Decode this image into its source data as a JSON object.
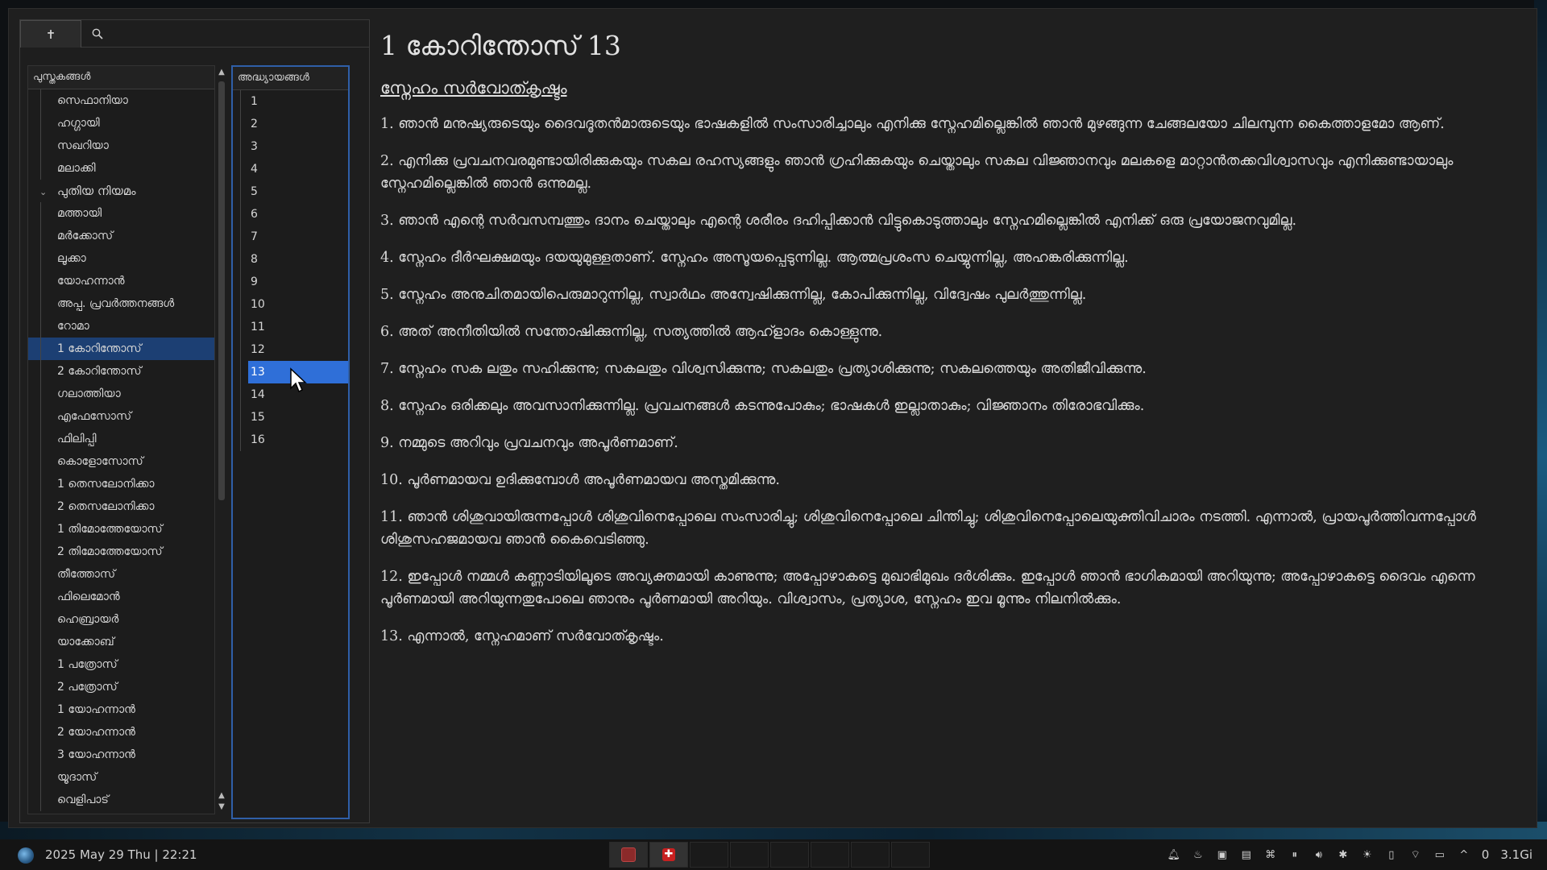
{
  "left_panel": {
    "tabs": [
      {
        "icon": "cross-icon",
        "glyph": "✝"
      },
      {
        "icon": "search-icon",
        "glyph": "🔍"
      }
    ],
    "books_header": "പുസ്തകങ്ങൾ",
    "chapters_header": "അദ്ധ്യായങ്ങൾ",
    "books": [
      {
        "label": "സെഫാനിയാ",
        "type": "book"
      },
      {
        "label": "ഹഗ്ഗായി",
        "type": "book"
      },
      {
        "label": "സഖറിയാ",
        "type": "book"
      },
      {
        "label": "മലാക്കി",
        "type": "book"
      },
      {
        "label": "പുതിയ നിയമം",
        "type": "section"
      },
      {
        "label": "മത്തായി",
        "type": "book"
      },
      {
        "label": "മർക്കോസ്",
        "type": "book"
      },
      {
        "label": "ലൂക്കാ",
        "type": "book"
      },
      {
        "label": "യോഹന്നാൻ",
        "type": "book"
      },
      {
        "label": "അപ്പ. പ്രവർത്തനങ്ങൾ",
        "type": "book"
      },
      {
        "label": "റോമാ",
        "type": "book"
      },
      {
        "label": "1 കോറിന്തോസ്",
        "type": "book",
        "selected": true
      },
      {
        "label": "2 കോറിന്തോസ്",
        "type": "book"
      },
      {
        "label": "ഗലാത്തിയാ",
        "type": "book"
      },
      {
        "label": "എഫേസോസ്",
        "type": "book"
      },
      {
        "label": "ഫിലിപ്പി",
        "type": "book"
      },
      {
        "label": "കൊളോസോസ്",
        "type": "book"
      },
      {
        "label": "1 തെസലോനിക്കാ",
        "type": "book"
      },
      {
        "label": "2 തെസലോനിക്കാ",
        "type": "book"
      },
      {
        "label": "1 തിമോത്തേയോസ്",
        "type": "book"
      },
      {
        "label": "2 തിമോത്തേയോസ്",
        "type": "book"
      },
      {
        "label": "തീത്തോസ്",
        "type": "book"
      },
      {
        "label": "ഫിലെമോൻ",
        "type": "book"
      },
      {
        "label": "ഹെബ്രായർ",
        "type": "book"
      },
      {
        "label": "യാക്കോബ്",
        "type": "book"
      },
      {
        "label": "1 പത്രോസ്",
        "type": "book"
      },
      {
        "label": "2 പത്രോസ്",
        "type": "book"
      },
      {
        "label": "1 യോഹന്നാൻ",
        "type": "book"
      },
      {
        "label": "2 യോഹന്നാൻ",
        "type": "book"
      },
      {
        "label": "3 യോഹന്നാൻ",
        "type": "book"
      },
      {
        "label": "യൂദാസ്",
        "type": "book"
      },
      {
        "label": "വെളിപാട്",
        "type": "book"
      }
    ],
    "chapters": [
      "1",
      "2",
      "3",
      "4",
      "5",
      "6",
      "7",
      "8",
      "9",
      "10",
      "11",
      "12",
      "13",
      "14",
      "15",
      "16"
    ],
    "selected_chapter": "13"
  },
  "content": {
    "chapter_title": "1 കോറിന്തോസ് 13",
    "section_heading": "സ്നേഹം സർവോത്കൃഷ്ടം",
    "verses": [
      "1. ഞാൻ മനുഷ്യരുടെയും ദൈവദൂതൻമാരുടെയും ഭാഷകളിൽ സംസാരിച്ചാലും എനിക്കു സ്നേഹമില്ലെങ്കിൽ ഞാൻ മുഴങ്ങുന്ന ചേങ്ങലയോ ചിലമ്പുന്ന കൈത്താളമോ ആണ്.",
      "2. എനിക്കു പ്രവചനവരമുണ്ടായിരിക്കുകയും സകല രഹസ്യങ്ങളും ഞാൻ ഗ്രഹിക്കുകയും ചെയ്താലും സകല വിജ്ഞാനവും മലകളെ മാറ്റാൻതക്കവിശ്വാസവും എനിക്കുണ്ടായാലും സ്നേഹമില്ലെങ്കിൽ ഞാൻ ഒന്നുമല്ല.",
      "3. ഞാൻ എന്റെ സർവസമ്പത്തും ദാനം ചെയ്താലും എന്റെ ശരീരം ദഹിപ്പിക്കാൻ വിട്ടുകൊടുത്താലും സ്നേഹമില്ലെങ്കിൽ എനിക്ക് ഒരു പ്രയോജനവുമില്ല.",
      "4. സ്നേഹം ദീർഘക്ഷമയും ദയയുമുള്ളതാണ്. സ്നേഹം അസൂയപ്പെടുന്നില്ല. ആത്മപ്രശംസ ചെയ്യുന്നില്ല, അഹങ്കരിക്കുന്നില്ല.",
      "5. സ്നേഹം അനുചിതമായിപെരുമാറുന്നില്ല, സ്വാർഥം അന്വേഷിക്കുന്നില്ല, കോപിക്കുന്നില്ല, വിദ്വേഷം പുലർത്തുന്നില്ല.",
      "6. അത് അനീതിയിൽ സന്തോഷിക്കുന്നില്ല, സത്യത്തിൽ ആഹ്ളാദം കൊള്ളുന്നു.",
      "7. സ്നേഹം സക ലതും സഹിക്കുന്നു; സകലതും വിശ്വസിക്കുന്നു; സകലതും പ്രത്യാശിക്കുന്നു; സകലത്തെയും അതിജീവിക്കുന്നു.",
      "8. സ്നേഹം ഒരിക്കലും അവസാനിക്കുന്നില്ല. പ്രവചനങ്ങൾ കടന്നുപോകും; ഭാഷകൾ ഇല്ലാതാകും; വിജ്ഞാനം തിരോഭവിക്കും.",
      "9. നമ്മുടെ അറിവും പ്രവചനവും അപൂർണമാണ്.",
      "10. പൂർണമായവ ഉദിക്കുമ്പോൾ അപൂർണമായവ അസ്തമിക്കുന്നു.",
      "11. ഞാൻ ശിശുവായിരുന്നപ്പോൾ ശിശുവിനെപ്പോലെ സംസാരിച്ചു; ശിശുവിനെപ്പോലെ ചിന്തിച്ചു; ശിശുവിനെപ്പോലെയുക്തിവിചാരം നടത്തി. എന്നാൽ, പ്രായപൂർത്തിവന്നപ്പോൾ ശിശുസഹജമായവ ഞാൻ കൈവെടിഞ്ഞു.",
      "12. ഇപ്പോൾ നമ്മൾ കണ്ണാടിയിലൂടെ അവ്യക്തമായി കാണുന്നു; അപ്പോഴാകട്ടെ മുഖാഭിമുഖം ദർശിക്കും. ഇപ്പോൾ ഞാൻ ഭാഗികമായി അറിയുന്നു; അപ്പോഴാകട്ടെ ദൈവം എന്നെ പൂർണമായി അറിയുന്നതുപോലെ ഞാനും പൂർണമായി അറിയും. വിശ്വാസം, പ്രത്യാശ, സ്നേഹം ഇവ മൂന്നും നിലനിൽക്കും.",
      "13. എന്നാൽ, സ്നേഹമാണ് സർവോത്കൃഷ്ടം."
    ]
  },
  "taskbar": {
    "clock": "2025 May 29 Thu | 22:21",
    "tray_counter": "0",
    "memory": "3.1Gi"
  }
}
